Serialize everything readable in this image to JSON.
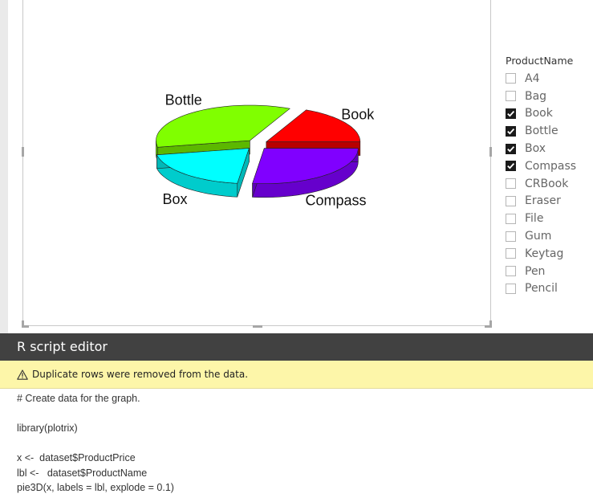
{
  "chart_data": {
    "type": "pie",
    "variant": "3d",
    "title": "",
    "categories": [
      "Book",
      "Bottle",
      "Box",
      "Compass"
    ],
    "values": [
      18,
      35,
      20,
      27
    ],
    "colors": [
      "#ff0000",
      "#80ff00",
      "#00ffff",
      "#8000ff"
    ],
    "labels": [
      "Book",
      "Bottle",
      "Box",
      "Compass"
    ]
  },
  "slicer": {
    "title": "ProductName",
    "items": [
      {
        "label": "A4",
        "checked": false
      },
      {
        "label": "Bag",
        "checked": false
      },
      {
        "label": "Book",
        "checked": true
      },
      {
        "label": "Bottle",
        "checked": true
      },
      {
        "label": "Box",
        "checked": true
      },
      {
        "label": "Compass",
        "checked": true
      },
      {
        "label": "CRBook",
        "checked": false
      },
      {
        "label": "Eraser",
        "checked": false
      },
      {
        "label": "File",
        "checked": false
      },
      {
        "label": "Gum",
        "checked": false
      },
      {
        "label": "Keytag",
        "checked": false
      },
      {
        "label": "Pen",
        "checked": false
      },
      {
        "label": "Pencil",
        "checked": false
      }
    ]
  },
  "editor": {
    "title": "R script editor",
    "warning": "Duplicate rows were removed from the data.",
    "warning_icon": "warning-triangle-icon",
    "code_lines": [
      "# Create data for the graph.",
      "",
      "library(plotrix)",
      "",
      "x <-  dataset$ProductPrice",
      "lbl <-   dataset$ProductName",
      "pie3D(x, labels = lbl, explode = 0.1)"
    ]
  }
}
